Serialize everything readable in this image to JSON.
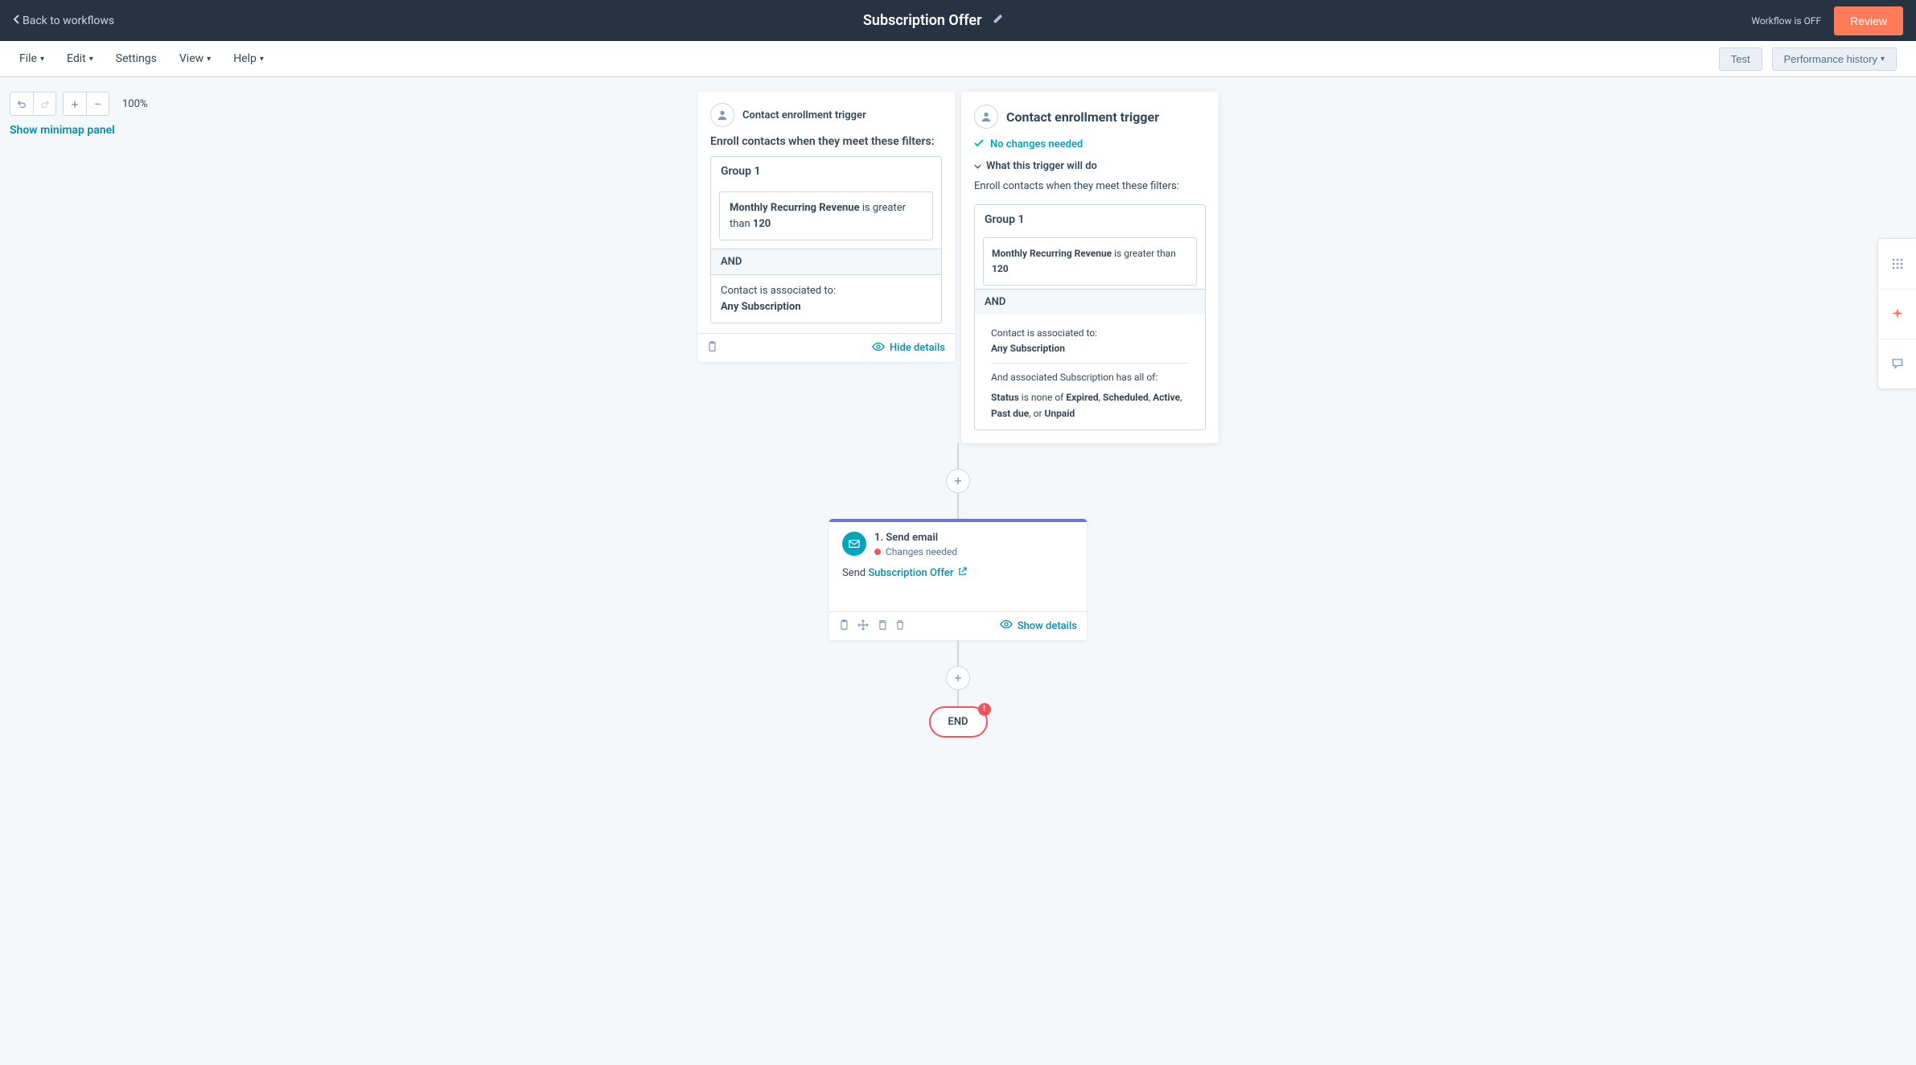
{
  "header": {
    "back_label": "Back to workflows",
    "title": "Subscription Offer",
    "status": "Workflow is OFF",
    "review_label": "Review"
  },
  "menubar": {
    "items": [
      "File",
      "Edit",
      "Settings",
      "View",
      "Help"
    ],
    "test_label": "Test",
    "performance_label": "Performance history"
  },
  "tools": {
    "zoom": "100%",
    "minimap_label": "Show minimap panel"
  },
  "trigger_card": {
    "title": "Contact enrollment trigger",
    "enroll_text": "Enroll contacts when they meet these filters:",
    "group_label": "Group 1",
    "filter_field": "Monthly Recurring Revenue",
    "filter_op": " is greater than ",
    "filter_value": "120",
    "and_label": "AND",
    "assoc_text": "Contact is associated to:",
    "assoc_value": "Any Subscription",
    "footer_link": "Hide details"
  },
  "details_panel": {
    "title": "Contact enrollment trigger",
    "status_ok": "No changes needed",
    "what_label": "What this trigger will do",
    "enroll_text": "Enroll contacts when they meet these filters:",
    "group_label": "Group 1",
    "filter_field": "Monthly Recurring Revenue",
    "filter_op": " is greater than ",
    "filter_value": "120",
    "and_label": "AND",
    "assoc_text": "Contact is associated to:",
    "assoc_value": "Any Subscription",
    "sub_text": "And associated Subscription has all of:",
    "status_field": "Status",
    "status_op": " is none of ",
    "status_vals": [
      "Expired",
      "Scheduled",
      "Active",
      "Past due",
      "Unpaid"
    ],
    "or_text": ", or "
  },
  "email_card": {
    "title": "1. Send email",
    "changes": "Changes needed",
    "send_prefix": "Send ",
    "link_label": "Subscription Offer",
    "footer_link": "Show details"
  },
  "end": {
    "label": "END"
  }
}
